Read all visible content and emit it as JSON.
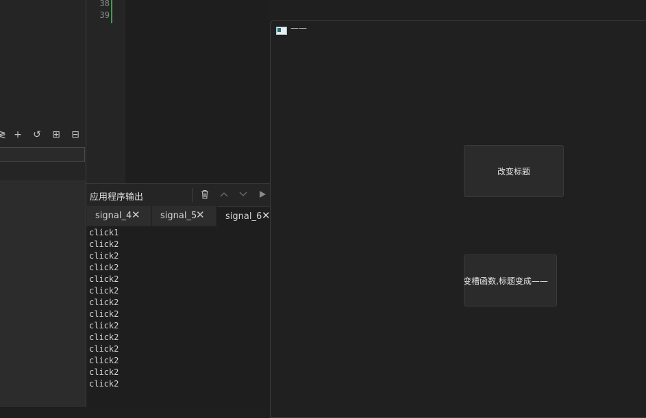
{
  "editor": {
    "line_numbers": [
      "38",
      "39"
    ]
  },
  "left_toolbar": {
    "icons": [
      "collapse-icon",
      "add-icon",
      "refresh-icon",
      "new-file-icon",
      "collapse-all-icon"
    ]
  },
  "output_panel": {
    "title": "应用程序输出",
    "tabs": [
      {
        "label": "signal_4",
        "active": false
      },
      {
        "label": "signal_5",
        "active": false
      },
      {
        "label": "signal_6",
        "active": true
      }
    ],
    "lines": [
      "click1",
      "click2",
      "click2",
      "click2",
      "click2",
      "click2",
      "click2",
      "click2",
      "click2",
      "click2",
      "click2",
      "click2",
      "click2",
      "click2"
    ]
  },
  "app_window": {
    "title": "——",
    "button_change_title": "改变标题",
    "button_slot": "改变槽函数,标题变成——"
  },
  "colors": {
    "git_added": "#3fa04a"
  }
}
